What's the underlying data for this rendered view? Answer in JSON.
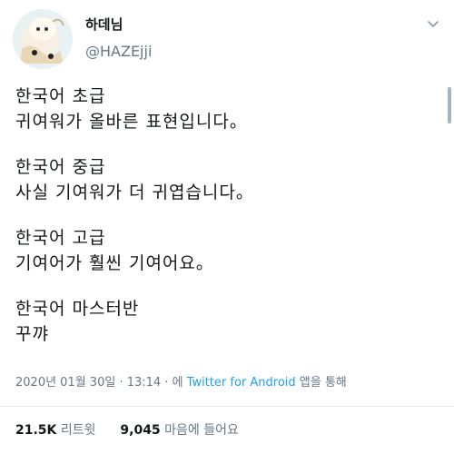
{
  "user": {
    "display_name": "하데님",
    "handle": "@HAZEjji"
  },
  "tweet": {
    "blocks": [
      {
        "heading": "한국어 초급",
        "text": "귀여워가 올바른 표현입니다。"
      },
      {
        "heading": "한국어 중급",
        "text": "사실 기여워가 더 귀엽습니다。"
      },
      {
        "heading": "한국어 고급",
        "text": "기여어가 훨씬 기여어요。"
      },
      {
        "heading": "한국어 마스터반",
        "text": "꾸꺄"
      }
    ],
    "timestamp": "2020년 01월 30일 · 13:14 · 에",
    "source": "Twitter for Android",
    "source_suffix": "앱을 통해"
  },
  "stats": {
    "retweets_count": "21.5K",
    "retweets_label": "리트윗",
    "likes_count": "9,045",
    "likes_label": "마음에 들어요"
  },
  "icons": {
    "menu": "chevron-down-icon"
  }
}
